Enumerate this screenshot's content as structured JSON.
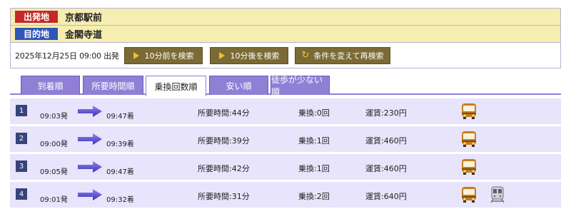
{
  "header": {
    "departure_label": "出発地",
    "departure_place": "京都駅前",
    "destination_label": "目的地",
    "destination_place": "金閣寺道",
    "datetime": "2025年12月25日 09:00 出発",
    "prev_button": "10分前を検索",
    "next_button": "10分後を検索",
    "research_button": "条件を変えて再検索"
  },
  "tabs": [
    {
      "label": "到着順",
      "active": false
    },
    {
      "label": "所要時間順",
      "active": false
    },
    {
      "label": "乗換回数順",
      "active": true
    },
    {
      "label": "安い順",
      "active": false
    },
    {
      "label": "徒歩が少ない順",
      "active": false
    }
  ],
  "routes": [
    {
      "no": "1",
      "dep": "09:03発",
      "arr": "09:47着",
      "duration": "所要時間:44分",
      "transfers": "乗換:0回",
      "fare": "運賃:230円",
      "vehicles": [
        "bus-icon"
      ]
    },
    {
      "no": "2",
      "dep": "09:00発",
      "arr": "09:39着",
      "duration": "所要時間:39分",
      "transfers": "乗換:1回",
      "fare": "運賃:460円",
      "vehicles": [
        "bus-icon"
      ]
    },
    {
      "no": "3",
      "dep": "09:05発",
      "arr": "09:47着",
      "duration": "所要時間:42分",
      "transfers": "乗換:1回",
      "fare": "運賃:460円",
      "vehicles": [
        "bus-icon"
      ]
    },
    {
      "no": "4",
      "dep": "09:01発",
      "arr": "09:32着",
      "duration": "所要時間:31分",
      "transfers": "乗換:2回",
      "fare": "運賃:640円",
      "vehicles": [
        "bus-icon",
        "train-icon"
      ]
    }
  ],
  "colors": {
    "header_bg": "#f5eeb0",
    "departure_tag": "#c6282a",
    "destination_tag": "#2f55b8",
    "button_bg": "#7b6a35",
    "tab_bg": "#8f80d6",
    "row_bg": "#e7e4fb",
    "arrow": "#5a4fd0"
  }
}
